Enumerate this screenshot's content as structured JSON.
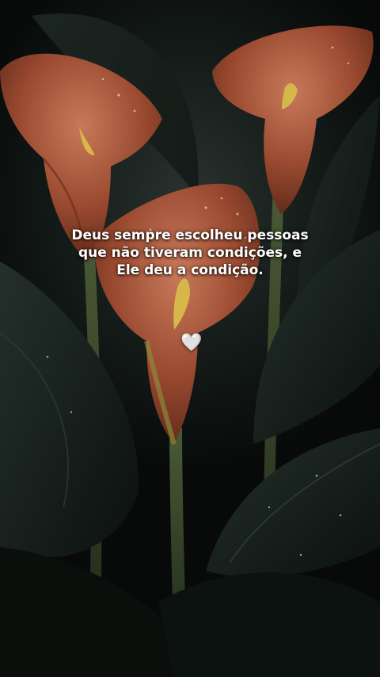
{
  "quote": {
    "text": "Deus sempre escolheu pessoas que não tiveram condições, e Ele deu a condição."
  },
  "heart": {
    "glyph": "🤍",
    "icon": "white-heart-icon",
    "color": "#ffffff"
  },
  "scene": {
    "subject": "calla-lily-flowers",
    "flower_color": "#a8553a",
    "leaf_color": "#16201c"
  }
}
